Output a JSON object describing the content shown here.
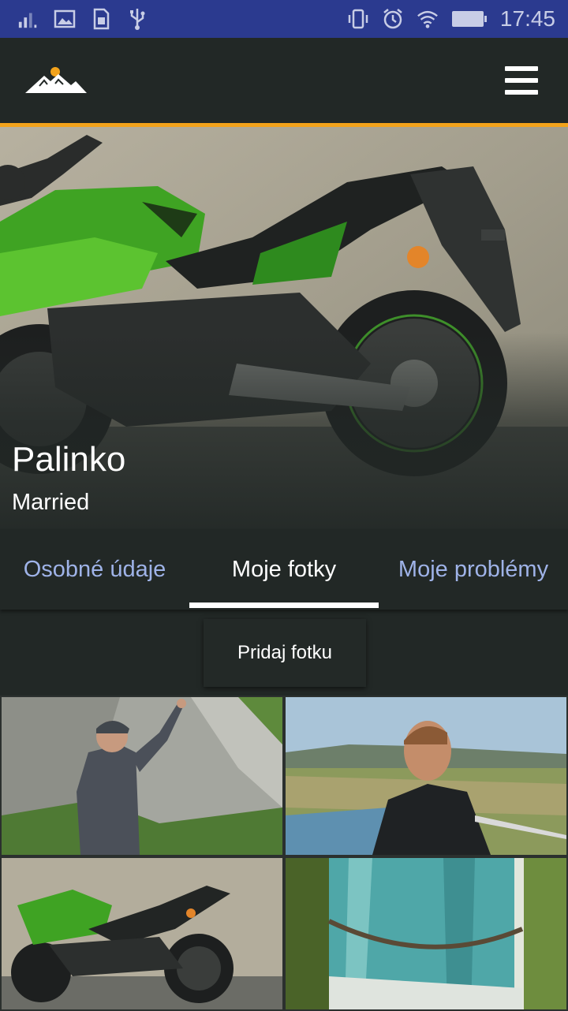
{
  "status_bar": {
    "time": "17:45",
    "icons_left": [
      "signal-icon",
      "image-icon",
      "sim-icon",
      "usb-icon"
    ],
    "icons_right": [
      "vibrate-icon",
      "alarm-icon",
      "wifi-icon",
      "battery-icon"
    ]
  },
  "app_bar": {
    "logo": "mountain-logo",
    "menu_icon": "hamburger-menu-icon"
  },
  "profile": {
    "name": "Palinko",
    "status": "Married",
    "cover_photo": "green-motorcycle"
  },
  "tabs": [
    {
      "label": "Osobné údaje",
      "active": false
    },
    {
      "label": "Moje fotky",
      "active": true
    },
    {
      "label": "Moje problémy",
      "active": false
    }
  ],
  "add_photo_label": "Pridaj fotku",
  "gallery": [
    {
      "subject": "climber-on-rock"
    },
    {
      "subject": "man-at-viewpoint"
    },
    {
      "subject": "green-motorcycle"
    },
    {
      "subject": "tree-trunk-closeup"
    }
  ],
  "colors": {
    "status_bar": "#2b3a8f",
    "app_bar": "#222826",
    "accent_line": "#f3a31b",
    "inactive_tab": "#9fb3e8"
  }
}
